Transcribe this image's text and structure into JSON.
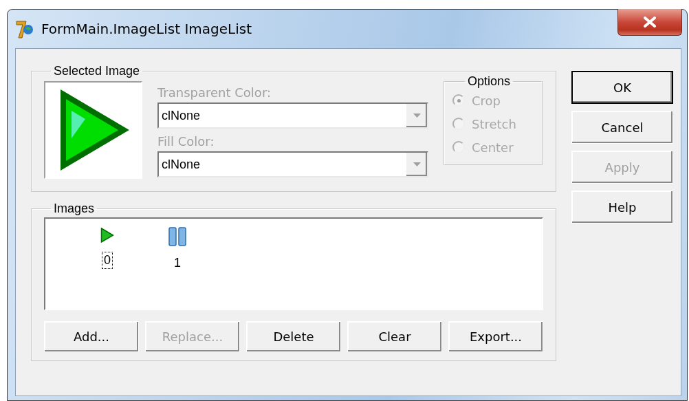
{
  "window": {
    "title": "FormMain.ImageList ImageList"
  },
  "selected_image": {
    "title": "Selected Image",
    "transparent_color": {
      "label": "Transparent Color:",
      "value": "clNone",
      "disabled": true
    },
    "fill_color": {
      "label": "Fill Color:",
      "value": "clNone",
      "disabled": true
    },
    "options": {
      "title": "Options",
      "items": [
        {
          "label": "Crop",
          "selected": true,
          "disabled": true
        },
        {
          "label": "Stretch",
          "selected": false,
          "disabled": true
        },
        {
          "label": "Center",
          "selected": false,
          "disabled": true
        }
      ]
    }
  },
  "images": {
    "title": "Images",
    "items": [
      {
        "caption": "0",
        "kind": "play",
        "selected": true
      },
      {
        "caption": "1",
        "kind": "pause",
        "selected": false
      }
    ]
  },
  "image_buttons": [
    {
      "label": "Add...",
      "disabled": false
    },
    {
      "label": "Replace...",
      "disabled": true
    },
    {
      "label": "Delete",
      "disabled": false
    },
    {
      "label": "Clear",
      "disabled": false
    },
    {
      "label": "Export...",
      "disabled": false
    }
  ],
  "dialog_buttons": [
    {
      "label": "OK",
      "default": true,
      "disabled": false
    },
    {
      "label": "Cancel",
      "default": false,
      "disabled": false
    },
    {
      "label": "Apply",
      "default": false,
      "disabled": true
    },
    {
      "label": "Help",
      "default": false,
      "disabled": false
    }
  ]
}
